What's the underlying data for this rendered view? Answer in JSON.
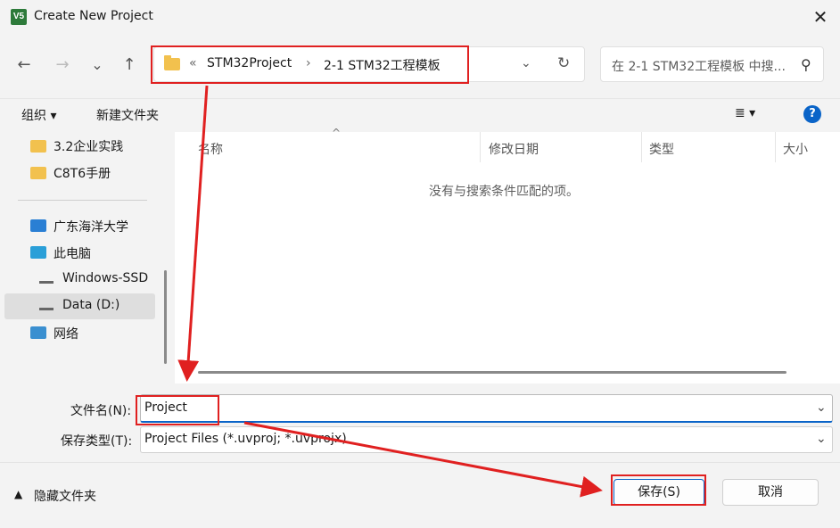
{
  "window": {
    "title": "Create New Project",
    "app_icon_text": "V5",
    "close_glyph": "✕"
  },
  "nav": {
    "back": "←",
    "forward": "→",
    "recent": "⌄",
    "up": "↑",
    "breadcrumb_overflow": "«",
    "breadcrumbs": [
      "STM32Project",
      "2-1 STM32工程模板"
    ],
    "separator": "›",
    "dropdown": "⌄",
    "refresh": "↻",
    "search_placeholder": "在 2-1 STM32工程模板 中搜...",
    "search_icon": "⚲"
  },
  "toolbar": {
    "organize": "组织 ▾",
    "new_folder": "新建文件夹",
    "view": "≣ ▾",
    "help": "?"
  },
  "sidebar": {
    "items": [
      {
        "label": "3.2企业实践",
        "icon": "folder-icon"
      },
      {
        "label": "C8T6手册",
        "icon": "folder-icon"
      },
      {
        "label": "广东海洋大学",
        "icon": "cloud-folder-icon"
      },
      {
        "label": "此电脑",
        "icon": "computer-icon"
      },
      {
        "label": "Windows-SSD",
        "icon": "drive-icon"
      },
      {
        "label": "Data (D:)",
        "icon": "drive-icon",
        "selected": true
      },
      {
        "label": "网络",
        "icon": "network-icon"
      }
    ]
  },
  "content": {
    "columns": [
      "名称",
      "修改日期",
      "类型",
      "大小"
    ],
    "sort_indicator": "^",
    "empty_message": "没有与搜索条件匹配的项。"
  },
  "form": {
    "filename_label": "文件名(N):",
    "filename_value": "Project",
    "filetype_label": "保存类型(T):",
    "filetype_value": "Project Files (*.uvproj; *.uvprojx)"
  },
  "footer": {
    "hide_folders": "隐藏文件夹",
    "save_button": "保存(S)",
    "cancel_button": "取消"
  },
  "colors": {
    "accent": "#0a64c8",
    "annotation": "#e02020",
    "folder": "#f2c14e"
  }
}
